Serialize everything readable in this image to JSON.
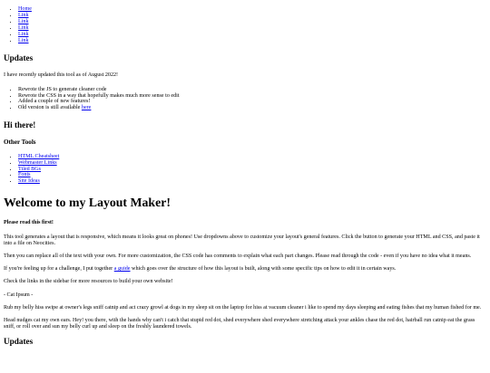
{
  "nav": {
    "links": [
      {
        "label": "Home"
      },
      {
        "label": "Link"
      },
      {
        "label": "Link"
      },
      {
        "label": "Link"
      },
      {
        "label": "Link"
      },
      {
        "label": "Link"
      }
    ]
  },
  "sidebar": {
    "updates_title": "Updates",
    "updates_intro": "I have recently updated this tool as of August 2022!",
    "updates_list": [
      "Rewrote the JS to generate cleaner code",
      "Rewrote the CSS in a way that hopefully makes much more sense to edit",
      "Added a couple of new features!"
    ],
    "old_version_text": "Old version is still available ",
    "old_version_link": "here",
    "hi_title": "Hi there!",
    "other_tools_title": "Other Tools",
    "tools": [
      {
        "label": "HTML Cheatsheet"
      },
      {
        "label": "Webmaster Links"
      },
      {
        "label": "Tiled BGs"
      },
      {
        "label": "Fonts"
      },
      {
        "label": "Site Ideas"
      }
    ]
  },
  "main": {
    "title": "Welcome to my Layout Maker!",
    "read_first": "Please read this first!",
    "p1": "This tool generates a layout that is responsive, which means it looks great on phones! Use dropdowns above to customize your layout's general features. Click the button to generate your HTML and CSS, and paste it into a file on Neocities.",
    "p2": "Then you can replace all of the text with your own. For more customization, the CSS code has comments to explain what each part changes. Please read through the code - even if you have no idea what it means.",
    "p3_before": "If you're feeling up for a challenge, I put together ",
    "p3_link": "a guide",
    "p3_after": " which goes over the structure of how this layout is built, along with some specific tips on how to edit it in certain ways.",
    "p4": "Check the links in the sidebar for more resources to build your own website!",
    "p5": "- Cat Ipsum -",
    "p6": "Rub my belly hiss swipe at owner's legs sniff catnip and act crazy growl at dogs in my sleep sit on the laptop for hiss at vacuum cleaner i like to spend my days sleeping and eating fishes that my human fished for me.",
    "p7": "Head nudges cat my own ears. Hey! you there, with the hands why can't i catch that stupid red dot, shed everywhere shed everywhere stretching attack your ankles chase the red dot, hairball run catnip eat the grass sniff, or roll over and sun my belly curl up and sleep on the freshly laundered towels.",
    "bottom_title": "Updates"
  }
}
